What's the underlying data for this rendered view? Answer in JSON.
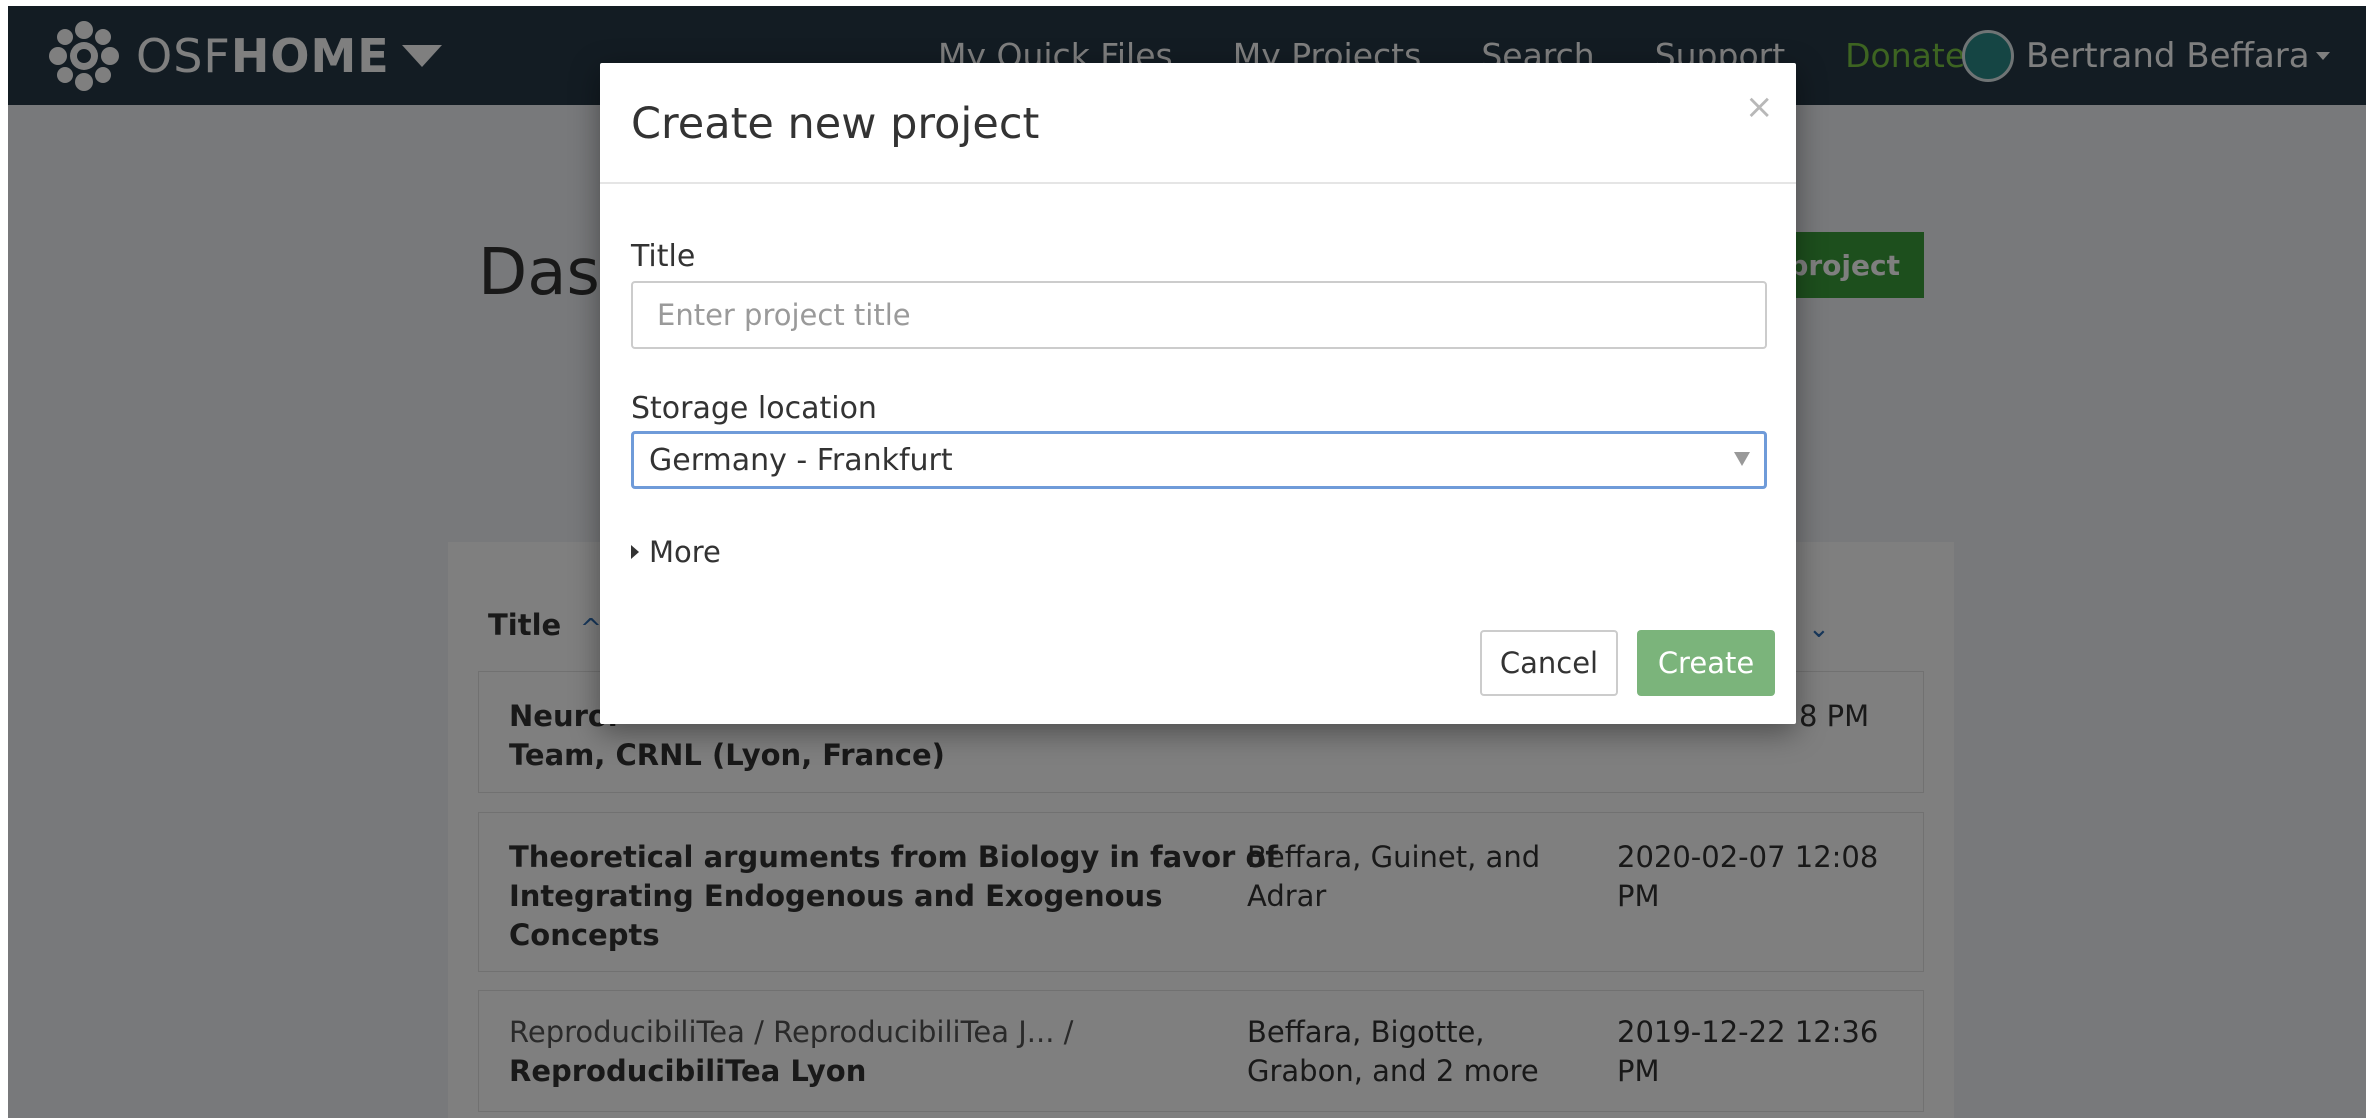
{
  "navbar": {
    "brand_prefix": "OSF",
    "brand_suffix": "HOME",
    "links": [
      "My Quick Files",
      "My Projects",
      "Search",
      "Support",
      "Donate"
    ],
    "user_name": "Bertrand Beffara",
    "donate_color": "#7ac943",
    "background_color": "#263947"
  },
  "dashboard": {
    "title": "Dash",
    "new_project_label": "project",
    "columns": {
      "title": "Title"
    },
    "rows": [
      {
        "title_line1": "Neuroi",
        "title_line2": "Team, CRNL (Lyon, France)",
        "date": "8 PM"
      },
      {
        "title_line1": "Theoretical arguments from Biology in favor of",
        "title_line2": "Integrating Endogenous and Exogenous",
        "title_line3": "Concepts",
        "contributors_line1": "Beffara, Guinet, and",
        "contributors_line2": "Adrar",
        "date": "2020-02-07 12:08 PM"
      },
      {
        "crumb": "ReproducibiliTea  /  ReproducibiliTea J...   /",
        "title_line2": "ReproducibiliTea Lyon",
        "contributors_line1": "Beffara, Bigotte,",
        "contributors_line2": "Grabon, and 2 more",
        "date": "2019-12-22 12:36 PM"
      }
    ]
  },
  "modal": {
    "title": "Create new project",
    "close_glyph": "×",
    "title_label": "Title",
    "title_input_value": "",
    "title_input_placeholder": "Enter project title",
    "storage_label": "Storage location",
    "storage_value": "Germany - Frankfurt",
    "more_label": "More",
    "cancel_label": "Cancel",
    "create_label": "Create",
    "create_color": "#7bb47b",
    "focus_border_color": "#6f9bd9"
  },
  "icons": {
    "brand": "osf-logo-icon",
    "brand_dropdown": "caret-down-icon",
    "user": "user-avatar-icon",
    "user_dropdown": "caret-down-icon",
    "select": "select-arrow-icon",
    "more": "caret-right-icon",
    "sort_asc": "chevron-up-icon",
    "sort_desc": "chevron-down-icon"
  }
}
